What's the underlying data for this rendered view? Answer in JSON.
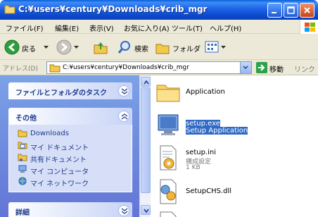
{
  "window": {
    "title": "C:¥users¥century¥Downloads¥crib_mgr"
  },
  "menu": [
    "ファイル(F)",
    "編集(E)",
    "表示(V)",
    "お気に入り(A)",
    "ツール(T)",
    "ヘルプ(H)"
  ],
  "toolbar": {
    "back_label": "戻る",
    "search_label": "検索",
    "folders_label": "フォルダ"
  },
  "address": {
    "label": "アドレス(D)",
    "value": "C:¥users¥century¥Downloads¥crib_mgr",
    "go_label": "移動",
    "links_label": "リンク"
  },
  "tasks": {
    "file_folder_tasks": "ファイルとフォルダのタスク",
    "other_places_title": "その他",
    "other_places": [
      "Downloads",
      "マイ ドキュメント",
      "共有ドキュメント",
      "マイ コンピュータ",
      "マイ ネットワーク"
    ],
    "details_title": "詳細"
  },
  "files": [
    {
      "name": "Application",
      "line2": "",
      "line3": "",
      "icon": "folder-icon",
      "selected": false
    },
    {
      "name": "setup.exe",
      "line2": "Setup Application",
      "line3": "",
      "icon": "setup-app-icon",
      "selected": true
    },
    {
      "name": "setup.ini",
      "line2": "構成設定",
      "line3": "1 KB",
      "icon": "config-file-icon",
      "selected": false
    },
    {
      "name": "SetupCHS.dll",
      "line2": "",
      "line3": "",
      "icon": "dll-file-icon",
      "selected": false
    }
  ],
  "colors": {
    "title_blue": "#0b48c9",
    "task_pane_blue": "#6f8de0",
    "selection": "#316ac5"
  }
}
